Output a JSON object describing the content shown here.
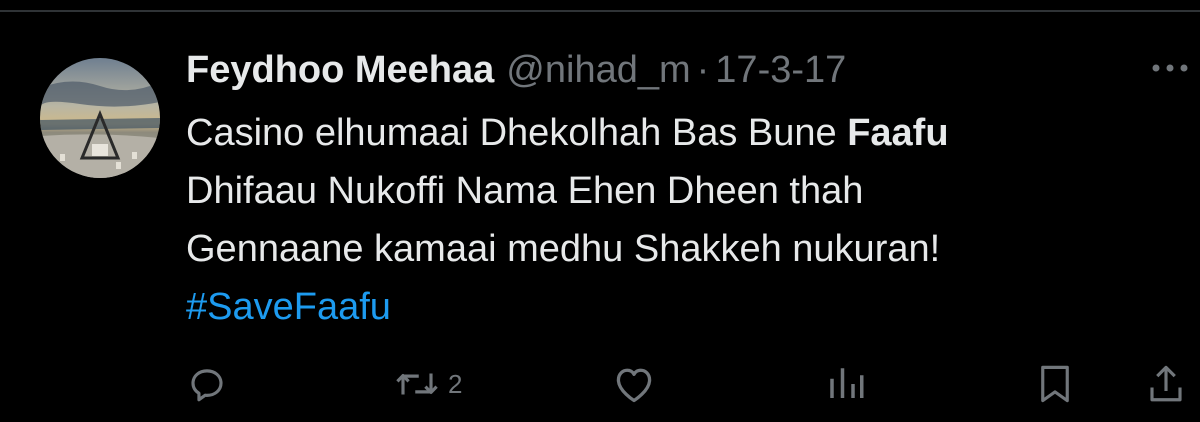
{
  "tweet": {
    "display_name": "Feydhoo Meehaa",
    "handle": "@nihad_m",
    "separator": "·",
    "date": "17-3-17",
    "text_lines": [
      {
        "before": "Casino elhumaai Dhekolhah Bas Bune ",
        "bold": "Faafu"
      },
      "Dhifaau Nukoffi Nama Ehen Dheen thah",
      "Gennaane kamaai medhu Shakkeh nukuran!"
    ],
    "hashtag": "#SaveFaafu"
  },
  "actions": {
    "reply_icon": "reply-icon",
    "retweet_icon": "retweet-icon",
    "retweet_count": "2",
    "like_icon": "heart-icon",
    "views_icon": "views-icon",
    "bookmark_icon": "bookmark-icon",
    "share_icon": "share-icon",
    "more_icon": "more-icon"
  },
  "colors": {
    "background": "#000000",
    "primary_text": "#e7e9ea",
    "secondary_text": "#71767b",
    "link": "#1d9bf0"
  }
}
